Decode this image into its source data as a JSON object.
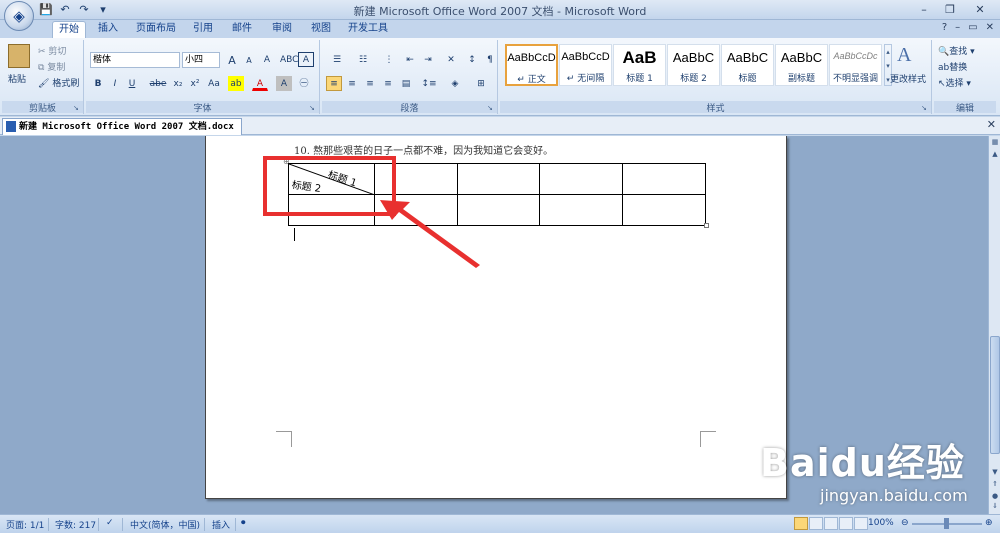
{
  "window": {
    "title": "新建 Microsoft Office Word 2007 文档 - Microsoft Word",
    "min": "–",
    "restore": "❐",
    "close": "✕"
  },
  "qat": {
    "save": "💾",
    "undo": "↶",
    "redo": "↷",
    "print": "▾"
  },
  "tabs": [
    "开始",
    "插入",
    "页面布局",
    "引用",
    "邮件",
    "审阅",
    "视图",
    "开发工具"
  ],
  "tabs_right": {
    "help": "?",
    "min": "–",
    "restore": "▭",
    "close": "✕"
  },
  "clipboard": {
    "paste": "粘贴",
    "cut": "剪切",
    "copy": "复制",
    "format_painter": "格式刷",
    "group_label": "剪贴板"
  },
  "font": {
    "font_name": "楷体",
    "font_size": "小四",
    "grow": "A",
    "shrink": "A",
    "clear": "A",
    "bold": "B",
    "italic": "I",
    "underline": "U",
    "strike": "abe",
    "sub": "x₂",
    "sup": "x²",
    "case": "Aa",
    "group_label": "字体"
  },
  "paragraph": {
    "group_label": "段落"
  },
  "styles": {
    "tiles": [
      {
        "sample": "AaBbCcD",
        "name": "↵ 正文"
      },
      {
        "sample": "AaBbCcD",
        "name": "↵ 无间隔"
      },
      {
        "sample": "AaB",
        "name": "标题 1"
      },
      {
        "sample": "AaBbC",
        "name": "标题 2"
      },
      {
        "sample": "AaBbC",
        "name": "标题"
      },
      {
        "sample": "AaBbC",
        "name": "副标题"
      },
      {
        "sample": "AaBbCcDc",
        "name": "不明显强调"
      }
    ],
    "change_styles": "更改样式",
    "group_label": "样式"
  },
  "editing": {
    "find": "查找",
    "replace": "替换",
    "select": "选择",
    "group_label": "编辑"
  },
  "document": {
    "tab_title": "新建 Microsoft Office Word 2007 文档.docx *",
    "line10": "10.   熬那些艰苦的日子一点都不难，因为我知道它会变好。",
    "cell_title1": "标题 1",
    "cell_title2": "标题 2"
  },
  "watermark": {
    "main": "Baidu经验",
    "sub": "jingyan.baidu.com"
  },
  "status": {
    "page": "页面: 1/1",
    "words": "字数: 217",
    "language": "中文(简体，中国)",
    "mode": "插入",
    "zoom": "100%"
  },
  "colors": {
    "highlight": "#e8302f",
    "ribbon_bg": "#dfe9f5",
    "workspace": "#8fa9c9"
  }
}
